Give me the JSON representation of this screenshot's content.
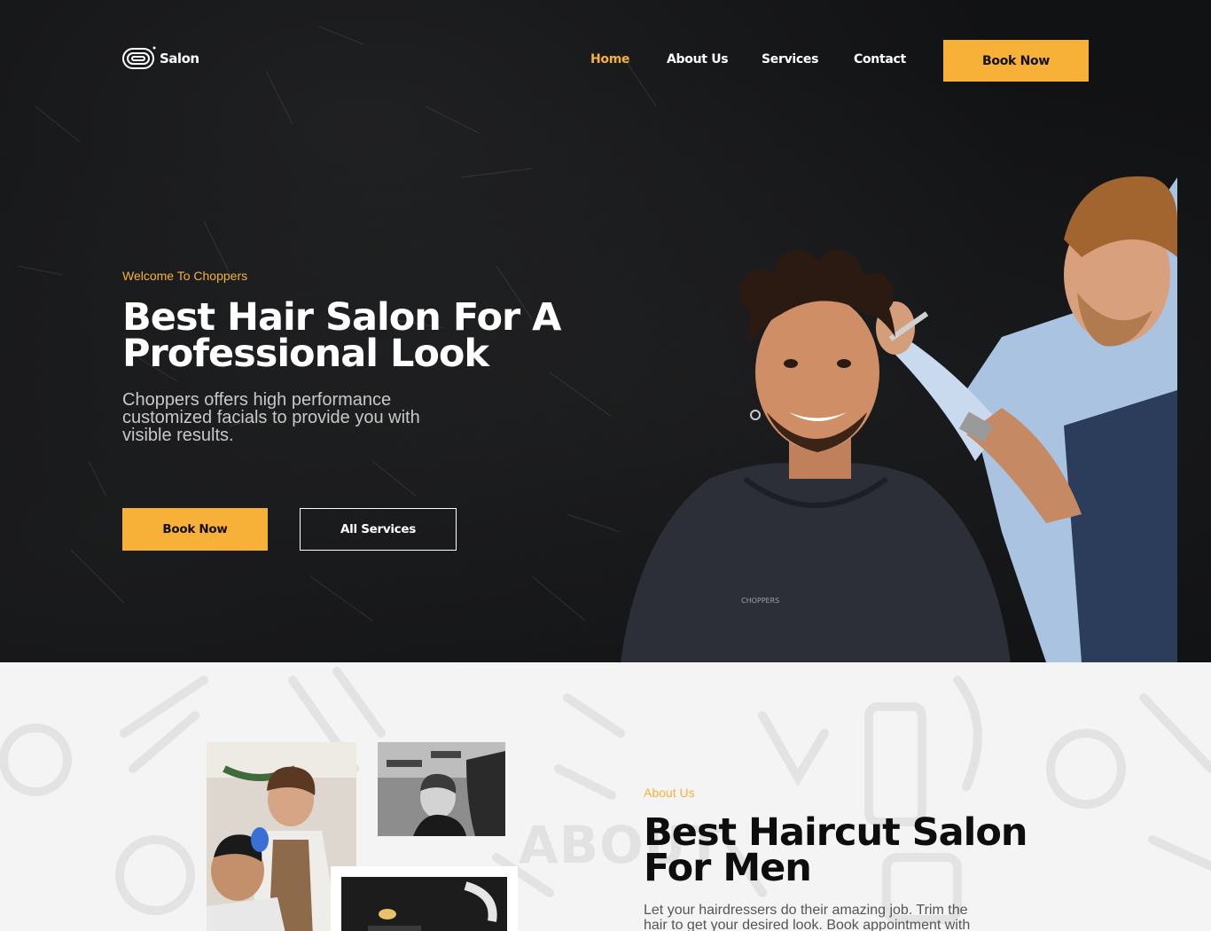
{
  "brand": {
    "logo_text": "Salon"
  },
  "nav": {
    "items": [
      {
        "label": "Home",
        "active": true
      },
      {
        "label": "About Us"
      },
      {
        "label": "Services"
      },
      {
        "label": "Contact"
      }
    ],
    "cta_label": "Book Now"
  },
  "hero": {
    "eyebrow": "Welcome To Choppers",
    "title": "Best Hair Salon For A Professional Look",
    "description": "Choppers offers high performance customized facials to provide you with visible results.",
    "primary_button": "Book Now",
    "secondary_button": "All Services",
    "cape_logo_text": "CHOPPERS"
  },
  "about": {
    "watermark": "ABOUT",
    "eyebrow": "About Us",
    "title": "Best Haircut Salon For Men",
    "description": "Let your hairdressers do their amazing job. Trim the hair to get your desired look. Book appointment with"
  },
  "colors": {
    "accent": "#f7b138",
    "dark": "#111214",
    "light_bg": "#f4f4f4"
  }
}
